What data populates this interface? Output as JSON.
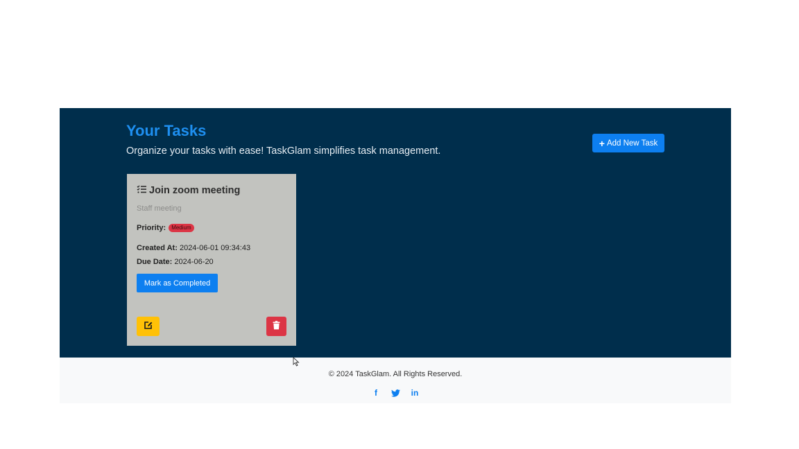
{
  "header": {
    "title": "Your Tasks",
    "subtitle": "Organize your tasks with ease! TaskGlam simplifies task management.",
    "add_button_label": "Add New Task"
  },
  "tasks": [
    {
      "title": "Join zoom meeting",
      "description": "Staff meeting",
      "priority_label": "Priority:",
      "priority": "Medium",
      "created_label": "Created At:",
      "created_at": "2024-06-01 09:34:43",
      "due_label": "Due Date:",
      "due_date": "2024-06-20",
      "complete_button_label": "Mark as Completed"
    }
  ],
  "footer": {
    "copyright": "© 2024 TaskGlam. All Rights Reserved.",
    "socials": [
      {
        "icon": "facebook-icon",
        "glyph": "f"
      },
      {
        "icon": "twitter-icon",
        "glyph": ""
      },
      {
        "icon": "linkedin-icon",
        "glyph": "in"
      }
    ]
  },
  "colors": {
    "panel_bg": "#002e4c",
    "title": "#1e8ff0",
    "primary_button": "#0d7ff0",
    "card_bg": "#c2c3bf",
    "priority_badge": "#dc3545",
    "edit_button": "#ffc107",
    "delete_button": "#dc3545",
    "footer_bg": "#f8f9fa"
  }
}
